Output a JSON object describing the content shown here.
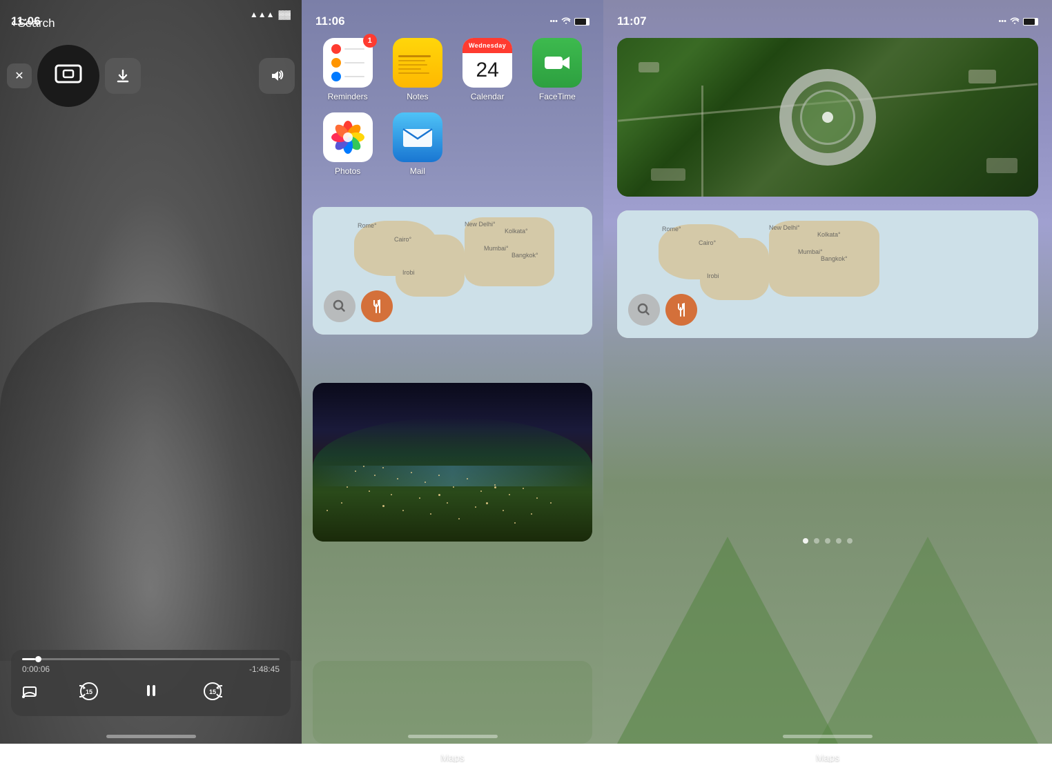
{
  "panel1": {
    "time": "11:06",
    "search_label": "Search",
    "time_elapsed": "0:00:06",
    "time_remaining": "-1:48:45",
    "progress_percent": 5
  },
  "panel2": {
    "time": "11:06",
    "apps": [
      {
        "id": "reminders",
        "label": "Reminders",
        "badge": "1"
      },
      {
        "id": "notes",
        "label": "Notes",
        "badge": ""
      },
      {
        "id": "calendar",
        "label": "Calendar",
        "badge": "",
        "day": "Wednesday",
        "date": "24"
      },
      {
        "id": "facetime",
        "label": "FaceTime",
        "badge": ""
      },
      {
        "id": "photos",
        "label": "Photos",
        "badge": ""
      },
      {
        "id": "mail",
        "label": "Mail",
        "badge": ""
      }
    ],
    "maps_label": "Maps",
    "map_locations": [
      "Rome",
      "Cairo",
      "New Delhi",
      "Kolkata",
      "Mumbai",
      "Bangkok",
      "Irobi"
    ]
  },
  "panel3": {
    "time": "11:07",
    "maps_label": "Maps",
    "page_dots": [
      1,
      2,
      3,
      4,
      5
    ],
    "active_dot": 0
  },
  "icons": {
    "chevron_left": "‹",
    "search": "🔍",
    "wifi": "WiFi",
    "battery": "🔋",
    "play_tv": "▶",
    "download": "⬇",
    "volume": "🔊",
    "cast": "📺",
    "rewind": "⟳",
    "forward": "⟳",
    "pause": "⏸",
    "search_map": "🔍",
    "food": "🍴"
  }
}
